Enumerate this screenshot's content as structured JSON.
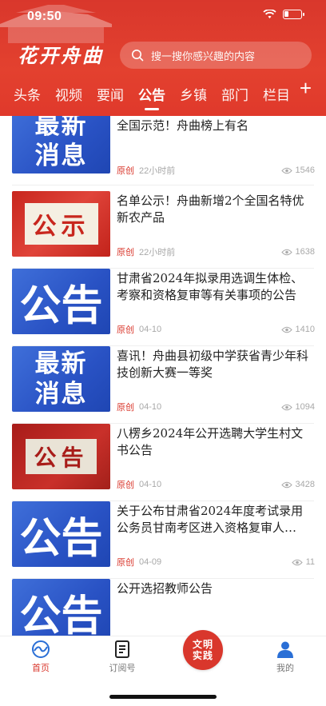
{
  "status_bar": {
    "time": "09:50"
  },
  "header": {
    "brand": "花开舟曲",
    "search_placeholder": "搜一搜你感兴趣的内容"
  },
  "tabs": [
    "头条",
    "视频",
    "要闻",
    "公告",
    "乡镇",
    "部门",
    "栏目"
  ],
  "active_tab": "公告",
  "tab_add_label": "+",
  "items": [
    {
      "thumb": {
        "style": "blue",
        "lines": [
          "最新",
          "消息"
        ]
      },
      "title": "全国示范！舟曲榜上有名",
      "source": "原创",
      "time": "22小时前",
      "views": "1546"
    },
    {
      "thumb": {
        "style": "red",
        "lines": [
          "公示"
        ]
      },
      "title": "名单公示！舟曲新增2个全国名特优新农产品",
      "source": "原创",
      "time": "22小时前",
      "views": "1638"
    },
    {
      "thumb": {
        "style": "blue",
        "lines": [
          "公告"
        ]
      },
      "title": "甘肃省2024年拟录用选调生体检、考察和资格复审等有关事项的公告",
      "source": "原创",
      "time": "04-10",
      "views": "1410"
    },
    {
      "thumb": {
        "style": "blue",
        "lines": [
          "最新",
          "消息"
        ]
      },
      "title": "喜讯！舟曲县初级中学获省青少年科技创新大赛一等奖",
      "source": "原创",
      "time": "04-10",
      "views": "1094"
    },
    {
      "thumb": {
        "style": "darkred",
        "lines": [
          "公告"
        ]
      },
      "title": "八楞乡2024年公开选聘大学生村文书公告",
      "source": "原创",
      "time": "04-10",
      "views": "3428"
    },
    {
      "thumb": {
        "style": "blue",
        "lines": [
          "公告"
        ]
      },
      "title": "关于公布甘肃省2024年度考试录用公务员甘南考区进入资格复审人…",
      "source": "原创",
      "time": "04-09",
      "views": "11"
    },
    {
      "thumb": {
        "style": "blue",
        "lines": [
          "公告"
        ]
      },
      "title": "公开选招教师公告",
      "source": "",
      "time": "",
      "views": ""
    }
  ],
  "bottom_nav": {
    "home": "首页",
    "subscriptions": "订阅号",
    "center_line1": "文明",
    "center_line2": "实践",
    "me": "我的"
  },
  "colors": {
    "brand_red": "#d9372c",
    "thumb_blue": "#2952c4"
  }
}
